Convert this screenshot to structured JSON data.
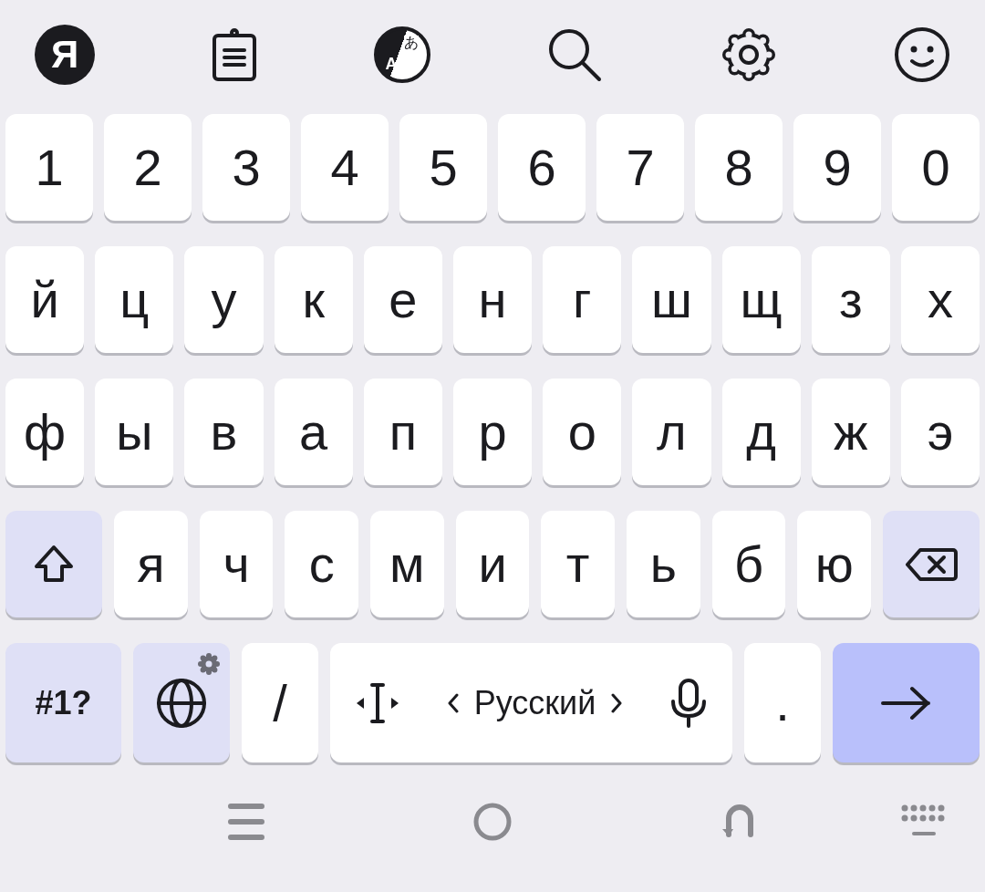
{
  "toolbar": [
    {
      "kind": "logo",
      "text": "Я"
    },
    {
      "kind": "clipboard"
    },
    {
      "kind": "translate",
      "glyphs": [
        "A",
        "あ"
      ]
    },
    {
      "kind": "search"
    },
    {
      "kind": "settings"
    },
    {
      "kind": "emoji"
    }
  ],
  "number_row": [
    "1",
    "2",
    "3",
    "4",
    "5",
    "6",
    "7",
    "8",
    "9",
    "0"
  ],
  "letter_rows": [
    [
      "й",
      "ц",
      "у",
      "к",
      "е",
      "н",
      "г",
      "ш",
      "щ",
      "з",
      "х"
    ],
    [
      "ф",
      "ы",
      "в",
      "а",
      "п",
      "р",
      "о",
      "л",
      "д",
      "ж",
      "э"
    ]
  ],
  "shift_row": [
    {
      "kind": "shift"
    },
    {
      "kind": "letter",
      "label": "я"
    },
    {
      "kind": "letter",
      "label": "ч"
    },
    {
      "kind": "letter",
      "label": "с"
    },
    {
      "kind": "letter",
      "label": "м"
    },
    {
      "kind": "letter",
      "label": "и"
    },
    {
      "kind": "letter",
      "label": "т"
    },
    {
      "kind": "letter",
      "label": "ь"
    },
    {
      "kind": "letter",
      "label": "б"
    },
    {
      "kind": "letter",
      "label": "ю"
    },
    {
      "kind": "backspace"
    }
  ],
  "bottom_row": [
    {
      "kind": "symbols",
      "label": "#1?"
    },
    {
      "kind": "language"
    },
    {
      "kind": "char",
      "label": "/"
    },
    {
      "kind": "space",
      "label": "Русский"
    },
    {
      "kind": "char",
      "label": "."
    },
    {
      "kind": "enter"
    }
  ],
  "nav_bar": [
    {
      "kind": "recents"
    },
    {
      "kind": "home"
    },
    {
      "kind": "back"
    },
    {
      "kind": "keyboard"
    }
  ]
}
